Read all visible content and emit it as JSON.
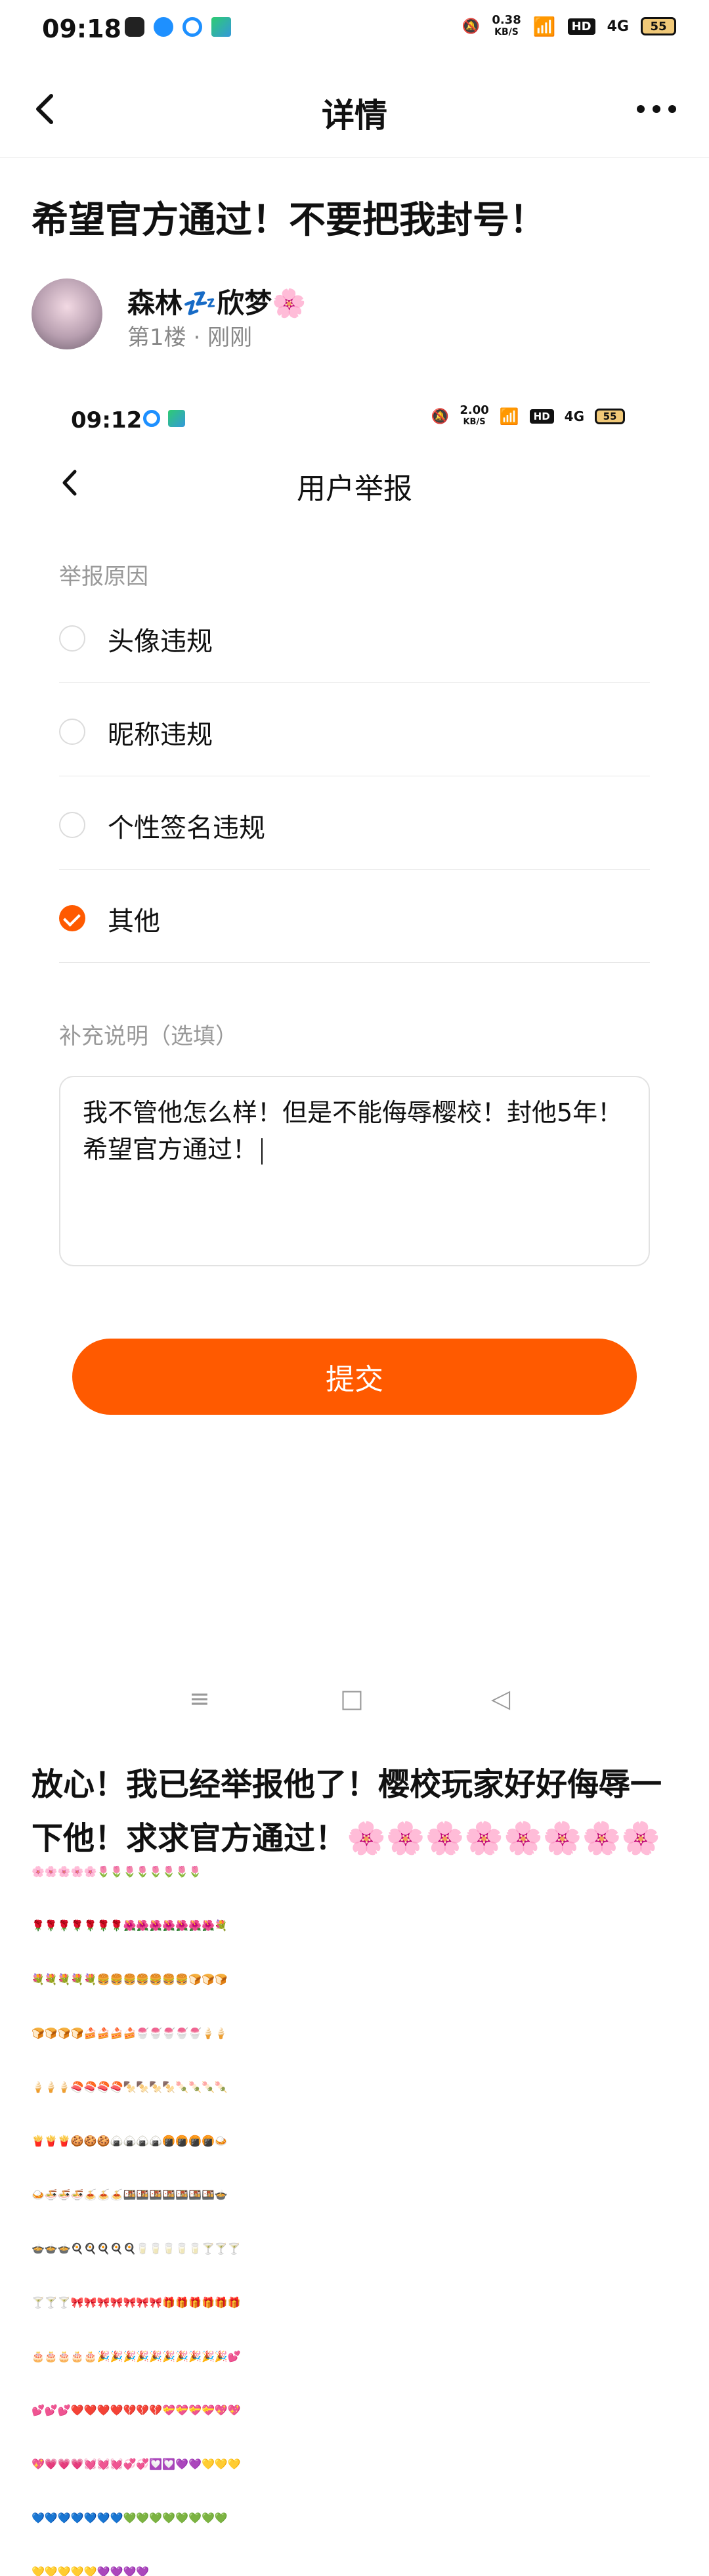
{
  "statusbar": {
    "time": "09:18",
    "net_speed_value": "0.38",
    "net_speed_unit": "KB/S",
    "hd": "HD",
    "signal": "4G",
    "battery": "55"
  },
  "nav": {
    "title": "详情",
    "back_icon": "chevron-left-icon",
    "more_icon": "more-dots-icon"
  },
  "post": {
    "title": "希望官方通过！不要把我封号！",
    "author_name": "森林💤欣梦🌸",
    "author_meta": "第1楼 · 刚刚"
  },
  "screenshot": {
    "time": "09:12",
    "net_speed_value": "2.00",
    "net_speed_unit": "KB/S",
    "hd": "HD",
    "signal": "4G",
    "battery": "55",
    "title": "用户举报",
    "reason_label": "举报原因",
    "options": [
      {
        "label": "头像违规",
        "checked": false
      },
      {
        "label": "昵称违规",
        "checked": false
      },
      {
        "label": "个性签名违规",
        "checked": false
      },
      {
        "label": "其他",
        "checked": true
      }
    ],
    "note_label": "补充说明（选填）",
    "note_text": "我不管他怎么样！但是不能侮辱樱校！封他5年！希望官方通过！",
    "submit_label": "提交",
    "nav_keys": [
      "≡",
      "□",
      "◁"
    ]
  },
  "reply": {
    "text": "放心！我已经举报他了！樱校玩家好好侮辱一下他！求求官方通过！",
    "emoji_rows": [
      "🌸🌸🌸🌸🌸🌸🌸🌸",
      "🌸🌸🌸🌸🌸🌷🌷🌷🌷🌷🌷🌷🌷",
      "🌹🌹🌹🌹🌹🌹🌹🌺🌺🌺🌺🌺🌺🌺💐",
      "💐💐💐💐💐🍔🍔🍔🍔🍔🍔🍔🍞🍞🍞",
      "🍞🍞🍞🍞🍰🍰🍰🍰🍧🍧🍧🍧🍧🍦🍦",
      "🍦🍦🍦🍣🍣🍣🍣🍢🍢🍢🍢🍡🍡🍡🍡",
      "🍟🍟🍟🍪🍪🍪🍙🍙🍙🍙🍘🍘🍘🍘🍛",
      "🍛🍜🍜🍜🍝🍝🍝🍱🍱🍱🍱🍱🍱🍱🍲",
      "🍲🍲🍲🍳🍳🍳🍳🍳🥛🥛🥛🥛🥛🍸🍸🍸",
      "🍸🍸🍸🎀🎀🎀🎀🎀🎀🎀🎁🎁🎁🎁🎁🎁",
      "🎂🎂🎂🎂🎂🎉🎉🎉🎉🎉🎉🎉🎉🎉🎉💕",
      "💕💕💕❤️❤️❤️❤️💔💔💔💝💝💝💝💖💖",
      "💖💗💗💗💓💓💓💞💞💟💟💜💜💛💛💛",
      "💙💙💙💙💙💙💙💚💚💚💚💚💚💚💚",
      "💛💛💛💛💛💜💜💜💜"
    ]
  },
  "colors": {
    "accent": "#ff5a00",
    "meta_gray": "#888888",
    "label_gray": "#999999"
  }
}
